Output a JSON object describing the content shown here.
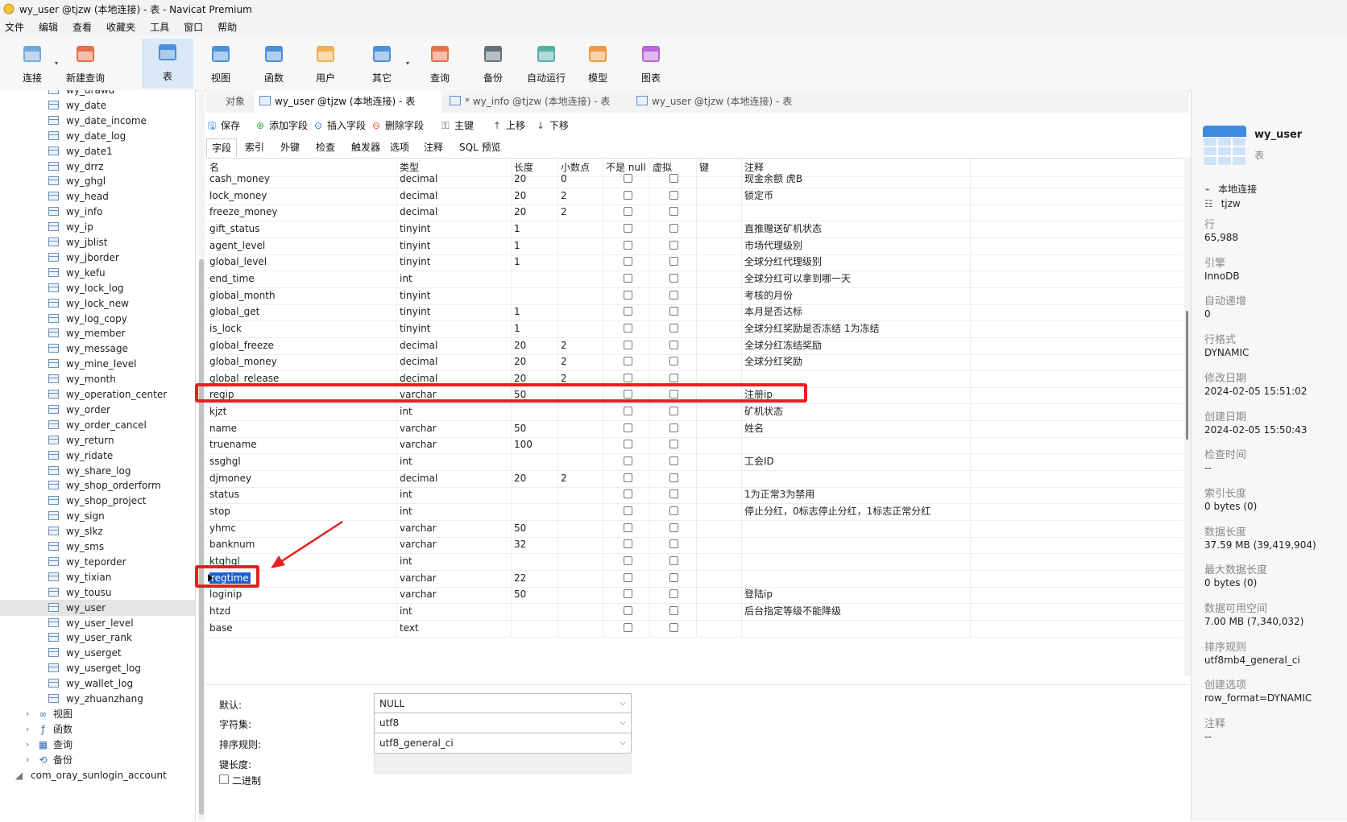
{
  "window_title": "wy_user @tjzw (本地连接) - 表 - Navicat Premium",
  "menu": [
    "文件",
    "编辑",
    "查看",
    "收藏夹",
    "工具",
    "窗口",
    "帮助"
  ],
  "toolbar": [
    {
      "label": "连接",
      "icon": "connection-icon"
    },
    {
      "label": "新建查询",
      "icon": "new-query-icon"
    },
    {
      "label": "表",
      "icon": "table-icon",
      "active": true
    },
    {
      "label": "视图",
      "icon": "view-icon"
    },
    {
      "label": "函数",
      "icon": "function-icon"
    },
    {
      "label": "用户",
      "icon": "user-icon"
    },
    {
      "label": "其它",
      "icon": "other-icon"
    },
    {
      "label": "查询",
      "icon": "query-icon"
    },
    {
      "label": "备份",
      "icon": "backup-icon"
    },
    {
      "label": "自动运行",
      "icon": "auto-run-icon"
    },
    {
      "label": "模型",
      "icon": "model-icon"
    },
    {
      "label": "图表",
      "icon": "chart-icon"
    }
  ],
  "tree": {
    "tables": [
      "wy_drawd",
      "wy_date",
      "wy_date_income",
      "wy_date_log",
      "wy_date1",
      "wy_drrz",
      "wy_ghgl",
      "wy_head",
      "wy_info",
      "wy_ip",
      "wy_jblist",
      "wy_jborder",
      "wy_kefu",
      "wy_lock_log",
      "wy_lock_new",
      "wy_log_copy",
      "wy_member",
      "wy_message",
      "wy_mine_level",
      "wy_month",
      "wy_operation_center",
      "wy_order",
      "wy_order_cancel",
      "wy_return",
      "wy_ridate",
      "wy_share_log",
      "wy_shop_orderform",
      "wy_shop_project",
      "wy_sign",
      "wy_slkz",
      "wy_sms",
      "wy_teporder",
      "wy_tixian",
      "wy_tousu",
      "wy_user",
      "wy_user_level",
      "wy_user_rank",
      "wy_userget",
      "wy_userget_log",
      "wy_wallet_log",
      "wy_zhuanzhang"
    ],
    "selected": "wy_user",
    "groups": [
      {
        "label": "视图",
        "icon": "view-icon"
      },
      {
        "label": "函数",
        "icon": "function-icon"
      },
      {
        "label": "查询",
        "icon": "query-icon"
      },
      {
        "label": "备份",
        "icon": "backup-icon"
      }
    ],
    "next_db": "com_oray_sunlogin_account"
  },
  "tabs": [
    {
      "label": "对象"
    },
    {
      "label": "wy_user @tjzw (本地连接) - 表",
      "active": true
    },
    {
      "label": "* wy_info @tjzw (本地连接) - 表"
    },
    {
      "label": "wy_user @tjzw (本地连接) - 表"
    }
  ],
  "field_toolbar": [
    {
      "label": "保存",
      "icon": "save-icon",
      "glyph": "🖫"
    },
    {
      "label": "添加字段",
      "icon": "add-icon",
      "glyph": "⊕"
    },
    {
      "label": "插入字段",
      "icon": "insert-icon",
      "glyph": "⊙"
    },
    {
      "label": "删除字段",
      "icon": "delete-icon",
      "glyph": "⊖"
    },
    {
      "label": "主键",
      "icon": "key-icon",
      "glyph": "⚿"
    },
    {
      "label": "上移",
      "icon": "arrow-up-icon",
      "glyph": "↑"
    },
    {
      "label": "下移",
      "icon": "arrow-down-icon",
      "glyph": "↓"
    }
  ],
  "subtabs": [
    "字段",
    "索引",
    "外键",
    "检查",
    "触发器",
    "选项",
    "注释",
    "SQL 预览"
  ],
  "columns": [
    "名",
    "类型",
    "长度",
    "小数点",
    "不是 null",
    "虚拟",
    "键",
    "注释"
  ],
  "rows": [
    {
      "name": "cash_money",
      "type": "decimal",
      "length": "20",
      "decimal": "0",
      "comment": "现金余额 虎B"
    },
    {
      "name": "lock_money",
      "type": "decimal",
      "length": "20",
      "decimal": "2",
      "comment": "锁定币"
    },
    {
      "name": "freeze_money",
      "type": "decimal",
      "length": "20",
      "decimal": "2",
      "comment": ""
    },
    {
      "name": "gift_status",
      "type": "tinyint",
      "length": "1",
      "decimal": "",
      "comment": "直推赠送矿机状态"
    },
    {
      "name": "agent_level",
      "type": "tinyint",
      "length": "1",
      "decimal": "",
      "comment": "市场代理级别"
    },
    {
      "name": "global_level",
      "type": "tinyint",
      "length": "1",
      "decimal": "",
      "comment": "全球分红代理级别"
    },
    {
      "name": "end_time",
      "type": "int",
      "length": "",
      "decimal": "",
      "comment": "全球分红可以拿到哪一天"
    },
    {
      "name": "global_month",
      "type": "tinyint",
      "length": "",
      "decimal": "",
      "comment": "考核的月份"
    },
    {
      "name": "global_get",
      "type": "tinyint",
      "length": "1",
      "decimal": "",
      "comment": "本月是否达标"
    },
    {
      "name": "is_lock",
      "type": "tinyint",
      "length": "1",
      "decimal": "",
      "comment": "全球分红奖励是否冻结 1为冻结"
    },
    {
      "name": "global_freeze",
      "type": "decimal",
      "length": "20",
      "decimal": "2",
      "comment": "全球分红冻结奖励"
    },
    {
      "name": "global_money",
      "type": "decimal",
      "length": "20",
      "decimal": "2",
      "comment": "全球分红奖励"
    },
    {
      "name": "global_release",
      "type": "decimal",
      "length": "20",
      "decimal": "2",
      "comment": ""
    },
    {
      "name": "regip",
      "type": "varchar",
      "length": "50",
      "decimal": "",
      "comment": "注册ip"
    },
    {
      "name": "kjzt",
      "type": "int",
      "length": "",
      "decimal": "",
      "comment": "矿机状态"
    },
    {
      "name": "name",
      "type": "varchar",
      "length": "50",
      "decimal": "",
      "comment": "姓名"
    },
    {
      "name": "truename",
      "type": "varchar",
      "length": "100",
      "decimal": "",
      "comment": ""
    },
    {
      "name": "ssghgl",
      "type": "int",
      "length": "",
      "decimal": "",
      "comment": "工会ID"
    },
    {
      "name": "djmoney",
      "type": "decimal",
      "length": "20",
      "decimal": "2",
      "comment": ""
    },
    {
      "name": "status",
      "type": "int",
      "length": "",
      "decimal": "",
      "comment": "1为正常3为禁用"
    },
    {
      "name": "stop",
      "type": "int",
      "length": "",
      "decimal": "",
      "comment": "停止分红，0标志停止分红，1标志正常分红"
    },
    {
      "name": "yhmc",
      "type": "varchar",
      "length": "50",
      "decimal": "",
      "comment": ""
    },
    {
      "name": "banknum",
      "type": "varchar",
      "length": "32",
      "decimal": "",
      "comment": ""
    },
    {
      "name": "ktghgl",
      "type": "int",
      "length": "",
      "decimal": "",
      "comment": ""
    },
    {
      "name": "regtime",
      "type": "varchar",
      "length": "22",
      "decimal": "",
      "comment": "",
      "selected": true
    },
    {
      "name": "loginip",
      "type": "varchar",
      "length": "50",
      "decimal": "",
      "comment": "登陆ip"
    },
    {
      "name": "htzd",
      "type": "int",
      "length": "",
      "decimal": "",
      "comment": "后台指定等级不能降级"
    },
    {
      "name": "base",
      "type": "text",
      "length": "",
      "decimal": "",
      "comment": ""
    }
  ],
  "props": {
    "default_label": "默认:",
    "default_value": "NULL",
    "charset_label": "字符集:",
    "charset_value": "utf8",
    "collation_label": "排序规则:",
    "collation_value": "utf8_general_ci",
    "keylen_label": "键长度:",
    "binary_label": "二进制"
  },
  "info": {
    "title": "wy_user",
    "subtitle": "表",
    "connection": "本地连接",
    "database": "tjzw",
    "items": [
      {
        "label": "行",
        "value": "65,988"
      },
      {
        "label": "引擎",
        "value": "InnoDB"
      },
      {
        "label": "自动递增",
        "value": "0"
      },
      {
        "label": "行格式",
        "value": "DYNAMIC"
      },
      {
        "label": "修改日期",
        "value": "2024-02-05 15:51:02"
      },
      {
        "label": "创建日期",
        "value": "2024-02-05 15:50:43"
      },
      {
        "label": "检查时间",
        "value": "--"
      },
      {
        "label": "索引长度",
        "value": "0 bytes (0)"
      },
      {
        "label": "数据长度",
        "value": "37.59 MB (39,419,904)"
      },
      {
        "label": "最大数据长度",
        "value": "0 bytes (0)"
      },
      {
        "label": "数据可用空间",
        "value": "7.00 MB (7,340,032)"
      },
      {
        "label": "排序规则",
        "value": "utf8mb4_general_ci"
      },
      {
        "label": "创建选项",
        "value": "row_format=DYNAMIC"
      },
      {
        "label": "注释",
        "value": "--"
      }
    ]
  },
  "colors": {
    "accent": "#1a5fd0",
    "highlight_box": "#e8201f",
    "toolbar_active": "#dbe8f6"
  }
}
